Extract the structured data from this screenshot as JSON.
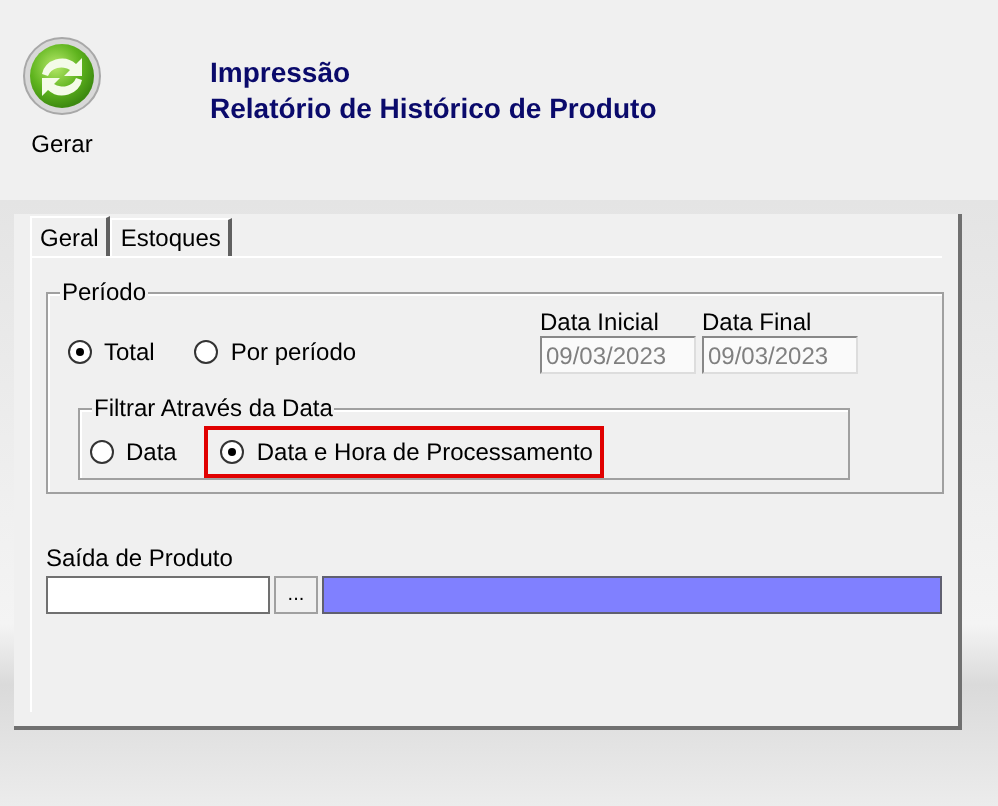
{
  "toolbar": {
    "buttons": [
      {
        "label": "Gerar"
      }
    ]
  },
  "header": {
    "lines": [
      "Impressão",
      "Relatório de Histórico de Produto"
    ]
  },
  "tabs": [
    {
      "label": "Geral",
      "selected": true
    },
    {
      "label": "Estoques",
      "selected": false
    }
  ],
  "periodo": {
    "title": "Período",
    "options": [
      {
        "label": "Total",
        "selected": true
      },
      {
        "label": "Por período",
        "selected": false
      }
    ],
    "dates": [
      {
        "label": "Data Inicial",
        "value": "09/03/2023",
        "disabled": true
      },
      {
        "label": "Data Final",
        "value": "09/03/2023",
        "disabled": true
      }
    ],
    "filtro": {
      "title": "Filtrar Através da Data",
      "options": [
        {
          "label": "Data",
          "selected": false,
          "highlighted": false
        },
        {
          "label": "Data e Hora de Processamento",
          "selected": true,
          "highlighted": true
        }
      ]
    }
  },
  "saida": {
    "label": "Saída de Produto",
    "browse_button": "..."
  }
}
